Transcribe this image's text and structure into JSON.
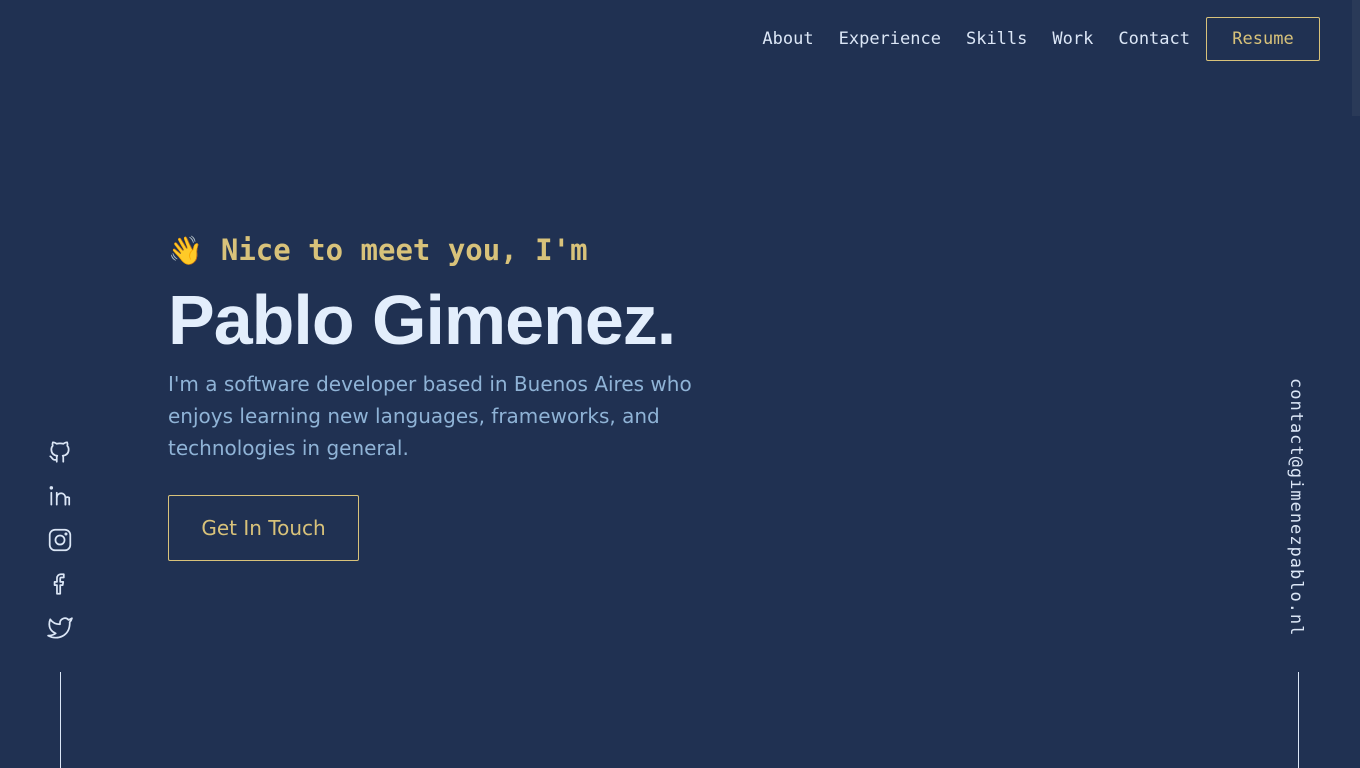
{
  "nav": {
    "links": [
      {
        "label": "About"
      },
      {
        "label": "Experience"
      },
      {
        "label": "Skills"
      },
      {
        "label": "Work"
      },
      {
        "label": "Contact"
      }
    ],
    "resume_label": "Resume"
  },
  "hero": {
    "wave_emoji": "👋",
    "greeting": "Nice to meet you, I'm",
    "name": "Pablo Gimenez.",
    "tagline": "I'm a software developer based in Buenos Aires who enjoys learning new languages, frameworks, and technologies in general.",
    "cta_label": "Get In Touch"
  },
  "socials": [
    {
      "icon": "github-icon"
    },
    {
      "icon": "linkedin-icon"
    },
    {
      "icon": "instagram-icon"
    },
    {
      "icon": "facebook-icon"
    },
    {
      "icon": "twitter-icon"
    }
  ],
  "contact": {
    "email": "contact@gimenezpablo.nl"
  },
  "colors": {
    "background": "#203152",
    "accent": "#d8c27a",
    "heading": "#e3eefc",
    "body_text": "#8fb3d6",
    "nav_text": "#dbe6f6"
  }
}
